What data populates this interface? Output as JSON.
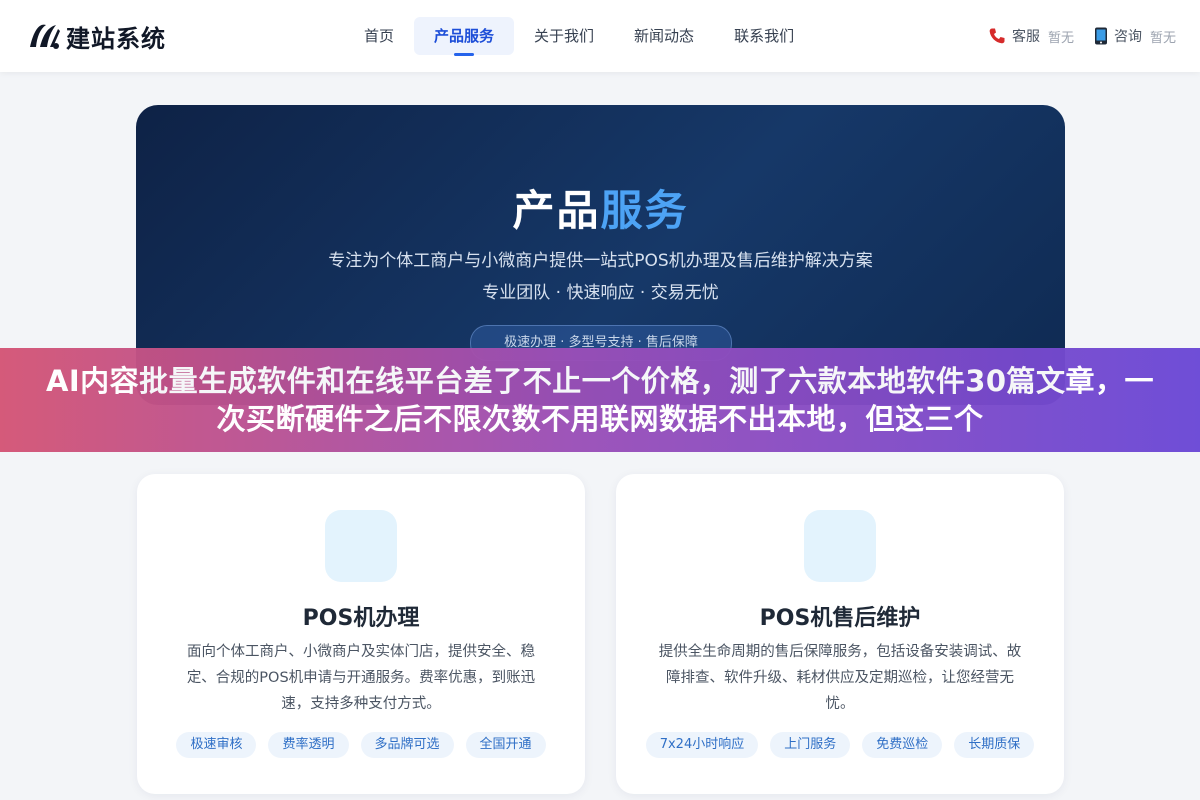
{
  "header": {
    "logo_text": "建站系统",
    "nav": [
      {
        "label": "首页",
        "active": false
      },
      {
        "label": "产品服务",
        "active": true
      },
      {
        "label": "关于我们",
        "active": false
      },
      {
        "label": "新闻动态",
        "active": false
      },
      {
        "label": "联系我们",
        "active": false
      }
    ],
    "contacts": [
      {
        "icon": "phone-icon",
        "label": "客服",
        "value": "暂无"
      },
      {
        "icon": "mobile-icon",
        "label": "咨询",
        "value": "暂无"
      }
    ]
  },
  "hero": {
    "title_main": "产品",
    "title_highlight": "服务",
    "subtitle": "专注为个体工商户与小微商户提供一站式POS机办理及售后维护解决方案",
    "subtitle2": "专业团队 · 快速响应 · 交易无忧",
    "pill": "极速办理 · 多型号支持 · 售后保障"
  },
  "banner": {
    "text": "AI内容批量生成软件和在线平台差了不止一个价格，测了六款本地软件30篇文章，一次买断硬件之后不限次数不用联网数据不出本地，但这三个"
  },
  "cards": [
    {
      "title": "POS机办理",
      "desc": "面向个体工商户、小微商户及实体门店，提供安全、稳定、合规的POS机申请与开通服务。费率优惠，到账迅速，支持多种支付方式。",
      "tags": [
        "极速审核",
        "费率透明",
        "多品牌可选",
        "全国开通"
      ]
    },
    {
      "title": "POS机售后维护",
      "desc": "提供全生命周期的售后保障服务，包括设备安装调试、故障排查、软件升级、耗材供应及定期巡检，让您经营无忧。",
      "tags": [
        "7x24小时响应",
        "上门服务",
        "免费巡检",
        "长期质保"
      ]
    }
  ],
  "colors": {
    "accent": "#2563eb",
    "hero_highlight": "#4da3f5",
    "hero_bg": "#163868",
    "tag_text": "#2f6fc6"
  }
}
